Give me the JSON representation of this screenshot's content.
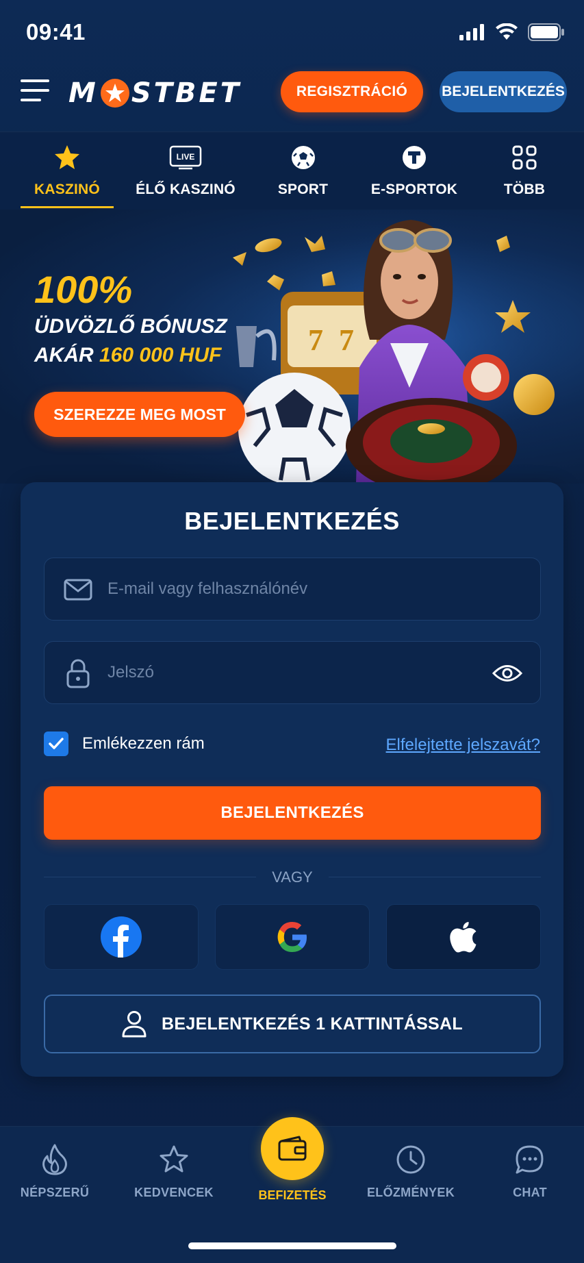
{
  "status_bar": {
    "time": "09:41"
  },
  "header": {
    "logo_left": "M",
    "logo_right": "STBET",
    "register_label": "REGISZTRÁCIÓ",
    "login_label": "BEJELENTKEZÉS"
  },
  "categories": [
    {
      "label": "KASZINÓ",
      "icon": "star-icon",
      "active": true
    },
    {
      "label": "ÉLŐ KASZINÓ",
      "icon": "live-icon",
      "icon_text": "LIVE"
    },
    {
      "label": "SPORT",
      "icon": "soccer-ball-icon"
    },
    {
      "label": "E-SPORTOK",
      "icon": "esports-icon"
    },
    {
      "label": "TÖBB",
      "icon": "grid-icon"
    }
  ],
  "hero": {
    "percent": "100%",
    "line1": "ÜDVÖZLŐ BÓNUSZ",
    "line2_prefix": "AKÁR ",
    "line2_highlight": "160 000 HUF",
    "cta_label": "SZEREZZE MEG MOST"
  },
  "login": {
    "title": "BEJELENTKEZÉS",
    "email_placeholder": "E-mail vagy felhasználónév",
    "password_placeholder": "Jelszó",
    "remember_label": "Emlékezzen rám",
    "remember_checked": true,
    "forgot_label": "Elfelejtette jelszavát?",
    "submit_label": "BEJELENTKEZÉS",
    "divider_label": "VAGY",
    "social": [
      "facebook-icon",
      "google-icon",
      "apple-icon"
    ],
    "one_click_label": "BEJELENTKEZÉS 1 KATTINTÁSSAL"
  },
  "bottom_nav": [
    {
      "label": "NÉPSZERŰ",
      "icon": "flame-icon"
    },
    {
      "label": "KEDVENCEK",
      "icon": "star-outline-icon"
    },
    {
      "label": "BEFIZETÉS",
      "icon": "wallet-icon",
      "active": true
    },
    {
      "label": "ELŐZMÉNYEK",
      "icon": "clock-icon"
    },
    {
      "label": "CHAT",
      "icon": "chat-icon"
    }
  ],
  "colors": {
    "accent_orange": "#ff5a0e",
    "accent_yellow": "#ffc21a",
    "link_blue": "#5ea8ff",
    "background": "#0b2348"
  }
}
